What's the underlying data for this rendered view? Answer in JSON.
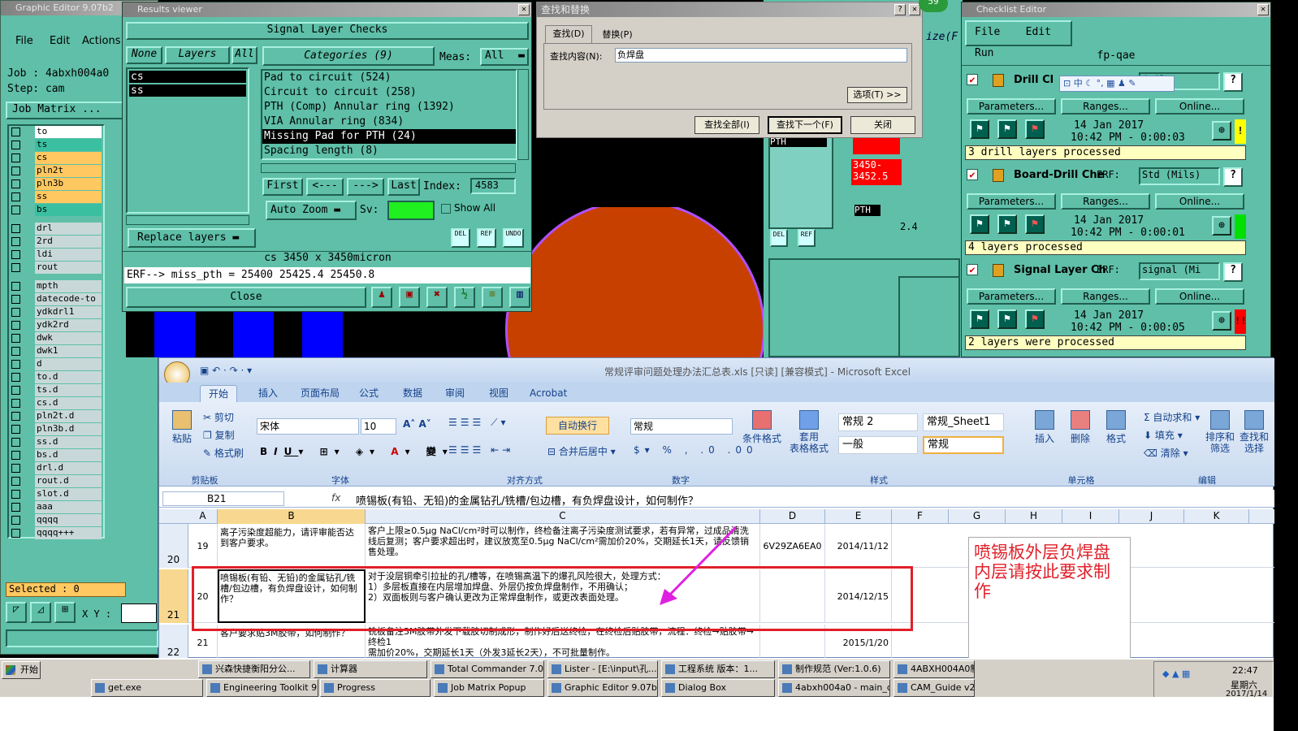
{
  "graphic_editor": {
    "title": "Graphic Editor 9.07b2",
    "menu": [
      "File",
      "Edit",
      "Actions"
    ],
    "job_label": "Job : 4abxh004a0",
    "step_label": "Step: cam",
    "job_matrix": "Job Matrix ...",
    "layers_top": [
      "to",
      "ts",
      "cs",
      "pln2t",
      "pln3b",
      "ss",
      "bs"
    ],
    "layers_mid": [
      "drl",
      "2rd",
      "ldi",
      "rout"
    ],
    "layers_bot": [
      "mpth",
      "datecode-to",
      "ydkdrl1",
      "ydk2rd",
      "dwk",
      "dwk1",
      "d",
      "to.d",
      "ts.d",
      "cs.d",
      "pln2t.d",
      "pln3b.d",
      "ss.d",
      "bs.d",
      "drl.d",
      "rout.d",
      "slot.d",
      "aaa",
      "qqqq",
      "qqqq+++"
    ],
    "selected": "Selected : 0",
    "xy_label": "X Y :"
  },
  "results": {
    "title": "Results viewer",
    "heading": "Signal Layer Checks",
    "none": "None",
    "layers": "Layers",
    "all": "All",
    "categories_label": "Categories (9)",
    "meas_label": "Meas:",
    "meas_value": "All",
    "layer_list": [
      "cs",
      "ss"
    ],
    "categories": [
      "Pad to circuit (524)",
      "Circuit to circuit (258)",
      "PTH (Comp) Annular ring (1392)",
      "VIA Annular ring (834)",
      "Missing Pad for PTH (24)",
      "Spacing length (8)"
    ],
    "selected_category": 4,
    "first": "First",
    "prev": "<---",
    "next": "--->",
    "last": "Last",
    "index_label": "Index:",
    "index_value": "4583",
    "auto_zoom": "Auto Zoom",
    "sv": "Sv:",
    "show_all": "Show All",
    "replace_layers": "Replace layers",
    "info": "cs 3450 x 3450micron",
    "erf_line": "ERF--> miss_pth = 25400 25425.4 25450.8",
    "close": "Close",
    "del": "DEL",
    "ref": "REF",
    "undo": "UNDO"
  },
  "find": {
    "title": "查找和替换",
    "tab_find": "查找(D)",
    "tab_replace": "替换(P)",
    "find_label": "查找内容(N):",
    "find_value": "负焊盘",
    "options": "选项(T) >>",
    "find_all": "查找全部(I)",
    "find_next": "查找下一个(F)",
    "close": "关闭",
    "badge": "59"
  },
  "canvas": {
    "size_label": "ize(F",
    "pth": "PTH",
    "num1": "3450-",
    "num2": "3452.5",
    "val": "2.4",
    "del": "DEL",
    "ref": "REF"
  },
  "checklist": {
    "title": "Checklist Editor",
    "menu": [
      "File",
      "Edit",
      "Run"
    ],
    "name": "fp-qae",
    "items": [
      {
        "name": "Drill Cl",
        "erf": "(Mil",
        "date": "14 Jan 2017",
        "time": "10:42 PM - 0:00:03",
        "status": "3 drill layers processed",
        "flag": "!",
        "flag_color": "#ffff00"
      },
      {
        "name": "Board-Drill Che",
        "erf": "Std (Mils)",
        "date": "14 Jan 2017",
        "time": "10:42 PM - 0:00:01",
        "status": "4 layers processed",
        "flag": "",
        "flag_color": "#00e000"
      },
      {
        "name": "Signal Layer Ch",
        "erf": "signal (Mi",
        "date": "14 Jan 2017",
        "time": "10:42 PM - 0:00:05",
        "status": "2 layers were processed",
        "flag": "!!",
        "flag_color": "#ff0000"
      }
    ],
    "erf_label": "ERF:",
    "parameters": "Parameters...",
    "ranges": "Ranges...",
    "online": "Online...",
    "ime": "中"
  },
  "excel": {
    "title": "常规评审问题处理办法汇总表.xls  [只读]  [兼容模式] - Microsoft Excel",
    "tabs": [
      "开始",
      "插入",
      "页面布局",
      "公式",
      "数据",
      "审阅",
      "视图",
      "Acrobat"
    ],
    "clipboard": {
      "paste": "粘贴",
      "cut": "剪切",
      "copy": "复制",
      "format": "格式刷",
      "label": "剪贴板"
    },
    "font": {
      "name": "宋体",
      "size": "10",
      "label": "字体"
    },
    "align": {
      "wrap": "自动换行",
      "merge": "合并后居中",
      "label": "对齐方式"
    },
    "number": {
      "format": "常规",
      "label": "数字"
    },
    "styles": {
      "cond": "条件格式",
      "table": "套用\n表格格式",
      "s1": "常规 2",
      "s2": "常规_Sheet1",
      "s3": "一般",
      "s4": "常规",
      "label": "样式"
    },
    "cells": {
      "insert": "插入",
      "delete": "删除",
      "format": "格式",
      "label": "单元格"
    },
    "edit": {
      "autosum": "自动求和",
      "fill": "填充",
      "clear": "清除",
      "sort": "排序和\n筛选",
      "find": "查找和\n选择",
      "label": "编辑"
    },
    "namebox": "B21",
    "fx": "fx",
    "formula": "喷锡板(有铅、无铅)的金属钻孔/铣槽/包边槽，有负焊盘设计，如何制作？",
    "cols": [
      "A",
      "B",
      "C",
      "D",
      "E",
      "F",
      "G",
      "H",
      "I",
      "J",
      "K"
    ],
    "rows": [
      {
        "num": "20",
        "a": "19",
        "b": "离子污染度超能力，请评审能否达到客户要求。",
        "c": "客户上限≥0.5μg NaCl/cm²时可以制作，终检备注离子污染度测试要求，若有异常，过成品清洗线后复测；客户要求超出时，建议放宽至0.5μg NaCl/cm²需加价20%，交期延长1天，请反馈销售处理。",
        "d": "6V29ZA6EA0",
        "e": "2014/11/12"
      },
      {
        "num": "21",
        "a": "20",
        "b": "喷锡板(有铅、无铅)的金属钻孔/铣槽/包边槽，有负焊盘设计，如何制作？",
        "c": "对于没层铜牵引拉扯的孔/槽等，在喷锡高温下的爆孔风险很大，处理方式：\n1）多层板直接在内层增加焊盘、外层仍按负焊盘制作，不用确认；\n2）双面板则与客户确认更改为正常焊盘制作，或更改表面处理。",
        "d": "",
        "e": "2014/12/15"
      },
      {
        "num": "22",
        "a": "21",
        "b": "客户要求贴3M胶带，如何制作？",
        "c": "铣板备注3M胶带外发下载胶切制成形，制作好后送终检，在终检后贴胶带，流程：终检→贴胶带→终检1\n需加价20%，交期延长1天（外发3延长2天），不可批量制作。",
        "d": "",
        "e": "2015/1/20"
      }
    ],
    "note": "喷锡板外层负焊盘  内层请按此要求制作"
  },
  "taskbar": {
    "start": "开始",
    "row1": [
      "兴森快捷衡阳分公...",
      "计算器",
      "Total Commander 7.0...",
      "Lister - [E:\\input\\孔...",
      "工程系统  版本：1...",
      "制作规范 (Ver:1.0.6)",
      "4ABXH004A0制"
    ],
    "row2": [
      "get.exe",
      "Engineering Toolkit 9....",
      "Progress",
      "Job Matrix Popup",
      "Graphic Editor 9.07b...",
      "Dialog Box",
      "4abxh004a0 - main_qa",
      "CAM_Guide v2"
    ],
    "time": "22:47",
    "weekday": "星期六",
    "date": "2017/1/14"
  }
}
